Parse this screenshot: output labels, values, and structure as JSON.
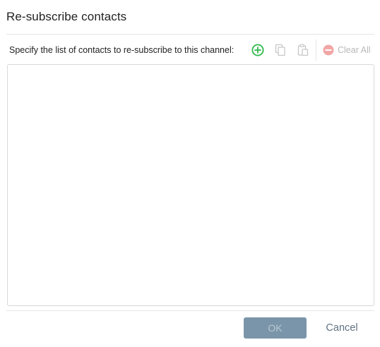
{
  "dialog": {
    "title": "Re-subscribe contacts",
    "instruction": "Specify the list of contacts to re-subscribe to this channel:",
    "contacts_value": "",
    "toolbar": {
      "add_icon": "add-circle-icon",
      "copy_icon": "copy-icon",
      "paste_icon": "paste-icon",
      "clear_all_icon": "minus-circle-icon",
      "clear_all_label": "Clear All"
    },
    "buttons": {
      "ok_label": "OK",
      "cancel_label": "Cancel"
    }
  },
  "colors": {
    "add_green": "#2fb84c",
    "disabled_gray": "#c6c6c6",
    "clear_red": "#f2a6a6",
    "ok_bg": "#7a95a9",
    "cancel_text": "#5f7282"
  }
}
